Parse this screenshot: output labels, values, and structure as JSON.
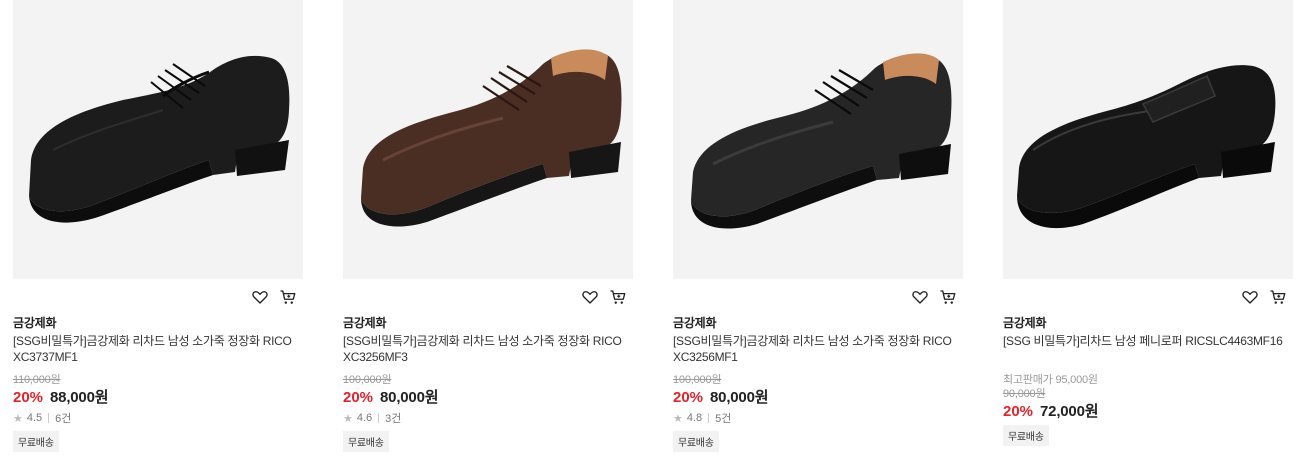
{
  "products": [
    {
      "brand": "금강제화",
      "title": "[SSG비밀특가]금강제화 리차드 남성 소가죽 정장화 RICOXC3737MF1",
      "original_price": "110,000원",
      "discount": "20%",
      "sale_price": "88,000원",
      "rating": "4.5",
      "reviews": "6건",
      "badge": "무료배송",
      "shoe_color": "#1c1c1c",
      "wish_icon": "heart-outline-icon",
      "cart_icon": "cart-icon"
    },
    {
      "brand": "금강제화",
      "title": "[SSG비밀특가]금강제화 리차드 남성 소가죽 정장화 RICOXC3256MF3",
      "original_price": "100,000원",
      "discount": "20%",
      "sale_price": "80,000원",
      "rating": "4.6",
      "reviews": "3건",
      "badge": "무료배송",
      "shoe_color": "#4a2e24",
      "wish_icon": "heart-outline-icon",
      "cart_icon": "cart-icon"
    },
    {
      "brand": "금강제화",
      "title": "[SSG비밀특가]금강제화 리차드 남성 소가죽 정장화 RICOXC3256MF1",
      "original_price": "100,000원",
      "discount": "20%",
      "sale_price": "80,000원",
      "rating": "4.8",
      "reviews": "5건",
      "badge": "무료배송",
      "shoe_color": "#262626",
      "wish_icon": "heart-outline-icon",
      "cart_icon": "cart-icon"
    },
    {
      "brand": "금강제화",
      "title": "[SSG 비밀특가]리차드 남성 페니로퍼 RICSLC4463MF16",
      "max_price": "최고판매가 95,000원",
      "original_price": "90,000원",
      "discount": "20%",
      "sale_price": "72,000원",
      "badge": "무료배송",
      "shoe_color": "#161616",
      "wish_icon": "heart-outline-icon",
      "cart_icon": "cart-icon"
    }
  ],
  "colors": {
    "discount": "#e5212a",
    "thumb_bg": "#f3f3f3"
  }
}
